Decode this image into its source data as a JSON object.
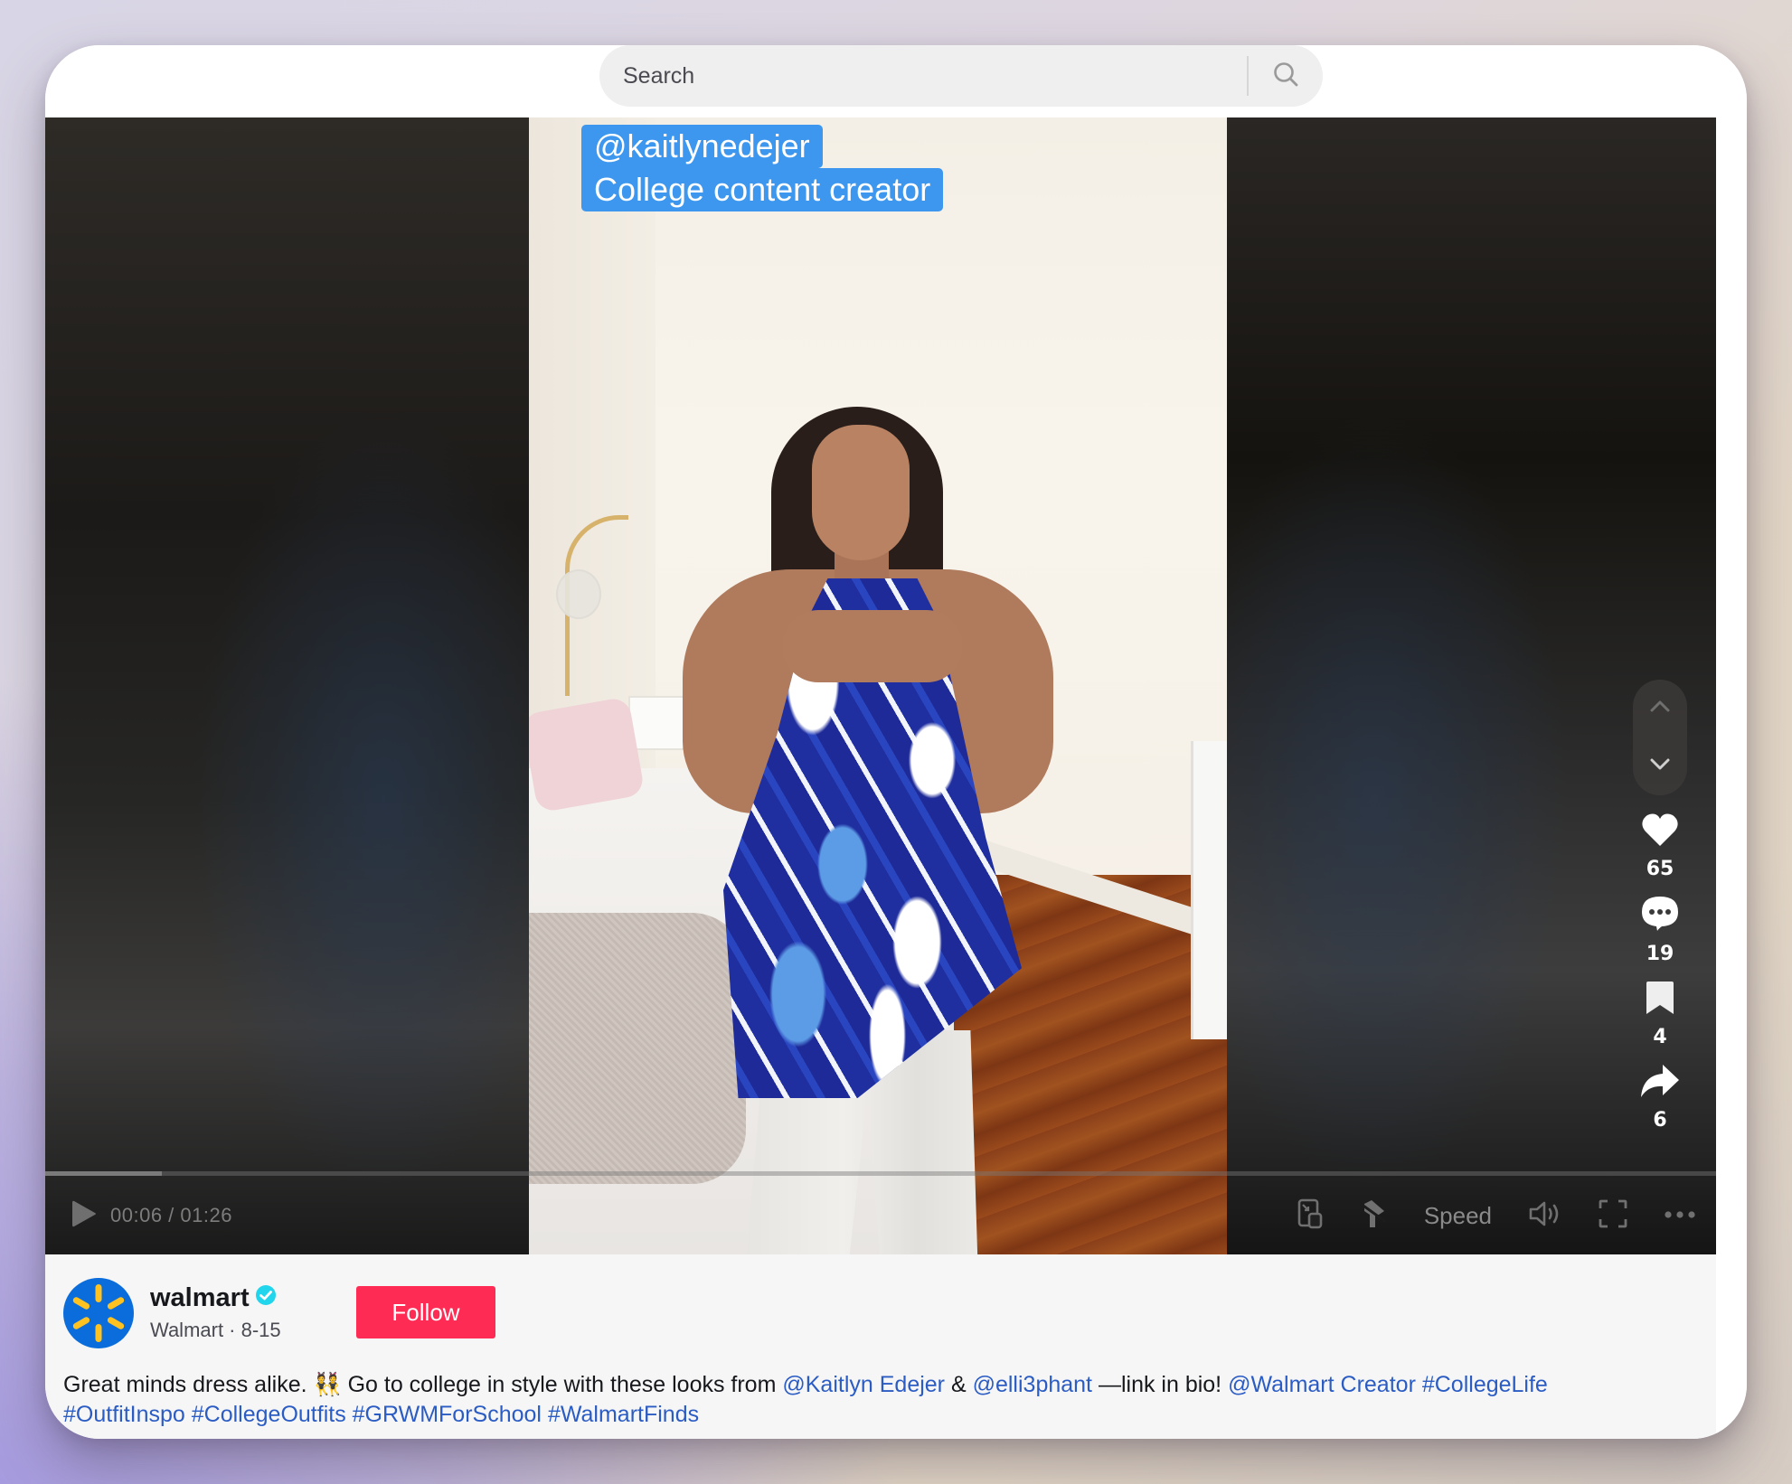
{
  "search": {
    "placeholder": "Search",
    "icon": "search-icon"
  },
  "video": {
    "overlay_text": {
      "line1": "@kaitlynedejer",
      "line2": "College content creator"
    },
    "overlay_color": "#3d97ee",
    "current_time": "00:06",
    "duration": "01:26",
    "time_display": "00:06 / 01:26",
    "progress_fraction": 0.07,
    "controls": {
      "play_icon": "play-icon",
      "mini_player_icon": "picture-in-picture-icon",
      "pin_icon": "pin-off-icon",
      "speed_label": "Speed",
      "volume_icon": "volume-icon",
      "fullscreen_icon": "fullscreen-icon",
      "more_icon": "more-horizontal-icon"
    }
  },
  "navigation": {
    "previous_icon": "chevron-up-icon",
    "next_icon": "chevron-down-icon"
  },
  "actions": {
    "likes": "65",
    "comments": "19",
    "saves": "4",
    "shares": "6"
  },
  "author": {
    "username": "walmart",
    "verified": true,
    "display_name": "Walmart",
    "date": "8-15",
    "meta": "Walmart · 8-15",
    "follow_label": "Follow",
    "follow_color": "#fe2c55",
    "avatar_color": "#0a6ddb",
    "avatar_spark_color": "#ffc220"
  },
  "description": {
    "text_1": "Great minds dress alike. ",
    "emoji": "👯",
    "text_2": " Go to college in style with these looks from ",
    "mention_1": "@Kaitlyn Edejer",
    "text_3": " & ",
    "mention_2": "@elli3phant",
    "text_4": " —link in bio! ",
    "mention_3": "@Walmart Creator",
    "hashtags": [
      "#CollegeLife",
      "#OutfitInspo",
      "#CollegeOutfits",
      "#GRWMForSchool",
      "#WalmartFinds"
    ],
    "link_color": "#2b5cc4"
  }
}
